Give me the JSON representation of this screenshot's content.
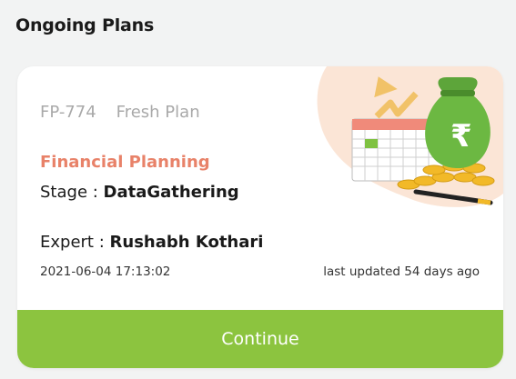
{
  "section": {
    "title": "Ongoing Plans"
  },
  "plan": {
    "id": "FP-774",
    "status": "Fresh Plan",
    "category": "Financial Planning",
    "stage_label": "Stage :",
    "stage_value": "DataGathering",
    "expert_label": "Expert :",
    "expert_value": "Rushabh Kothari",
    "created_at": "2021-06-04 17:13:02",
    "last_updated": "last updated 54 days ago",
    "action_label": "Continue",
    "illustration_icon": "money-bag-calendar-growth-icon"
  },
  "colors": {
    "accent_green": "#8cc43f",
    "category_orange": "#e88269",
    "meta_gray": "#a9a9a9"
  }
}
